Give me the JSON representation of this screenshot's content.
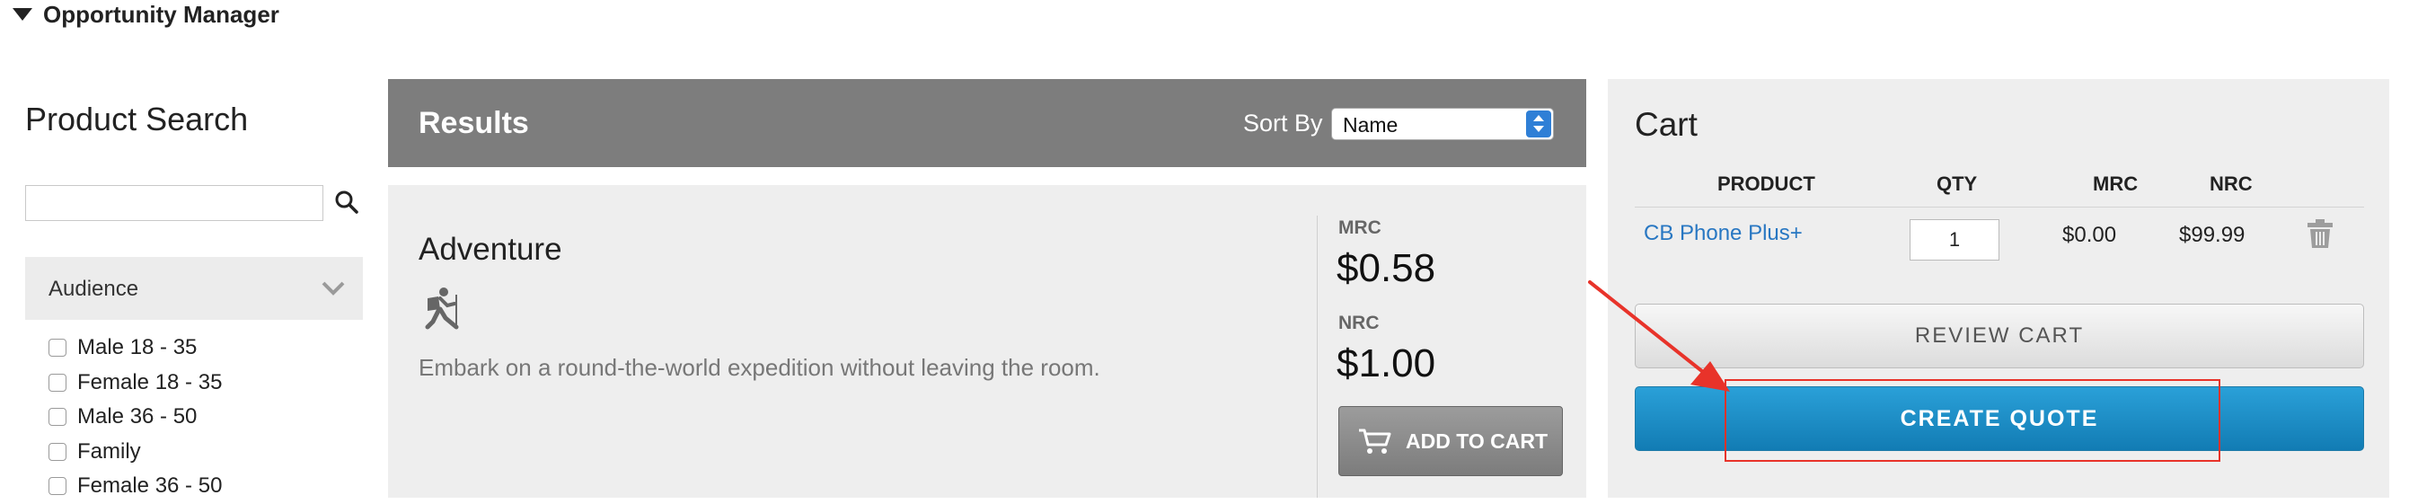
{
  "header": {
    "title": "Opportunity Manager"
  },
  "product_search": {
    "title": "Product Search",
    "search": {
      "value": "",
      "placeholder": ""
    },
    "audience": {
      "label": "Audience",
      "options": [
        "Male 18 - 35",
        "Female 18 - 35",
        "Male 36 - 50",
        "Family",
        "Female 36 - 50"
      ]
    }
  },
  "results": {
    "title": "Results",
    "sort_label": "Sort By",
    "sort_value": "Name",
    "product": {
      "name": "Adventure",
      "icon": "hiker-icon",
      "description": "Embark on a round-the-world expedition without leaving the room.",
      "mrc_label": "MRC",
      "mrc_value": "$0.58",
      "nrc_label": "NRC",
      "nrc_value": "$1.00",
      "add_label": "ADD TO CART"
    }
  },
  "cart": {
    "title": "Cart",
    "headers": {
      "product": "PRODUCT",
      "qty": "QTY",
      "mrc": "MRC",
      "nrc": "NRC"
    },
    "item": {
      "product": "CB Phone Plus+",
      "qty": "1",
      "mrc": "$0.00",
      "nrc": "$99.99"
    },
    "review_label": "REVIEW CART",
    "quote_label": "CREATE QUOTE"
  },
  "colors": {
    "results_bar": "#7d7d7d",
    "link": "#2877c2",
    "primary_button": "#1a8ac4",
    "annotation": "#e8332a"
  }
}
